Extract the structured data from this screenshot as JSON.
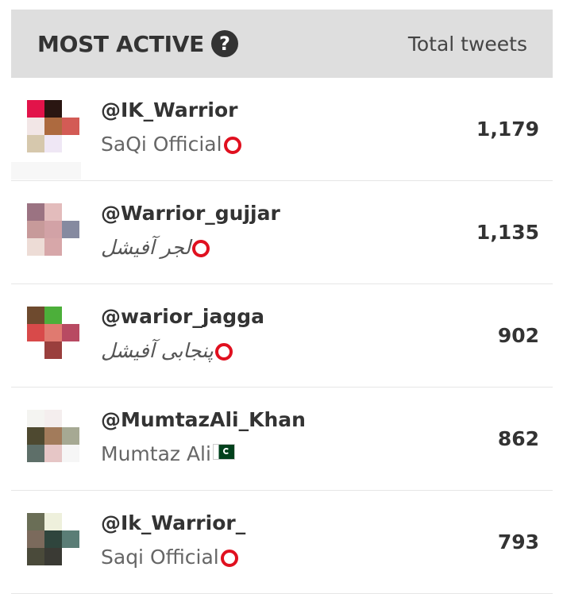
{
  "header": {
    "title": "MOST ACTIVE",
    "help_icon": "question-circle-icon",
    "column_label": "Total tweets"
  },
  "rows": [
    {
      "handle": "@IK_Warrior",
      "display_name": "SaQi Official",
      "badge": "red-circle",
      "count": "1,179"
    },
    {
      "handle": "@Warrior_gujjar",
      "display_name": "لجر آفیشل",
      "badge": "red-circle",
      "count": "1,135"
    },
    {
      "handle": "@warior_jagga",
      "display_name": "پنجابی آفیشل",
      "badge": "red-circle",
      "count": "902"
    },
    {
      "handle": "@MumtazAli_Khan",
      "display_name": "Mumtaz Ali",
      "badge": "pakistan-flag",
      "count": "862"
    },
    {
      "handle": "@Ik_Warrior_",
      "display_name": "Saqi Official",
      "badge": "red-circle",
      "count": "793"
    }
  ]
}
